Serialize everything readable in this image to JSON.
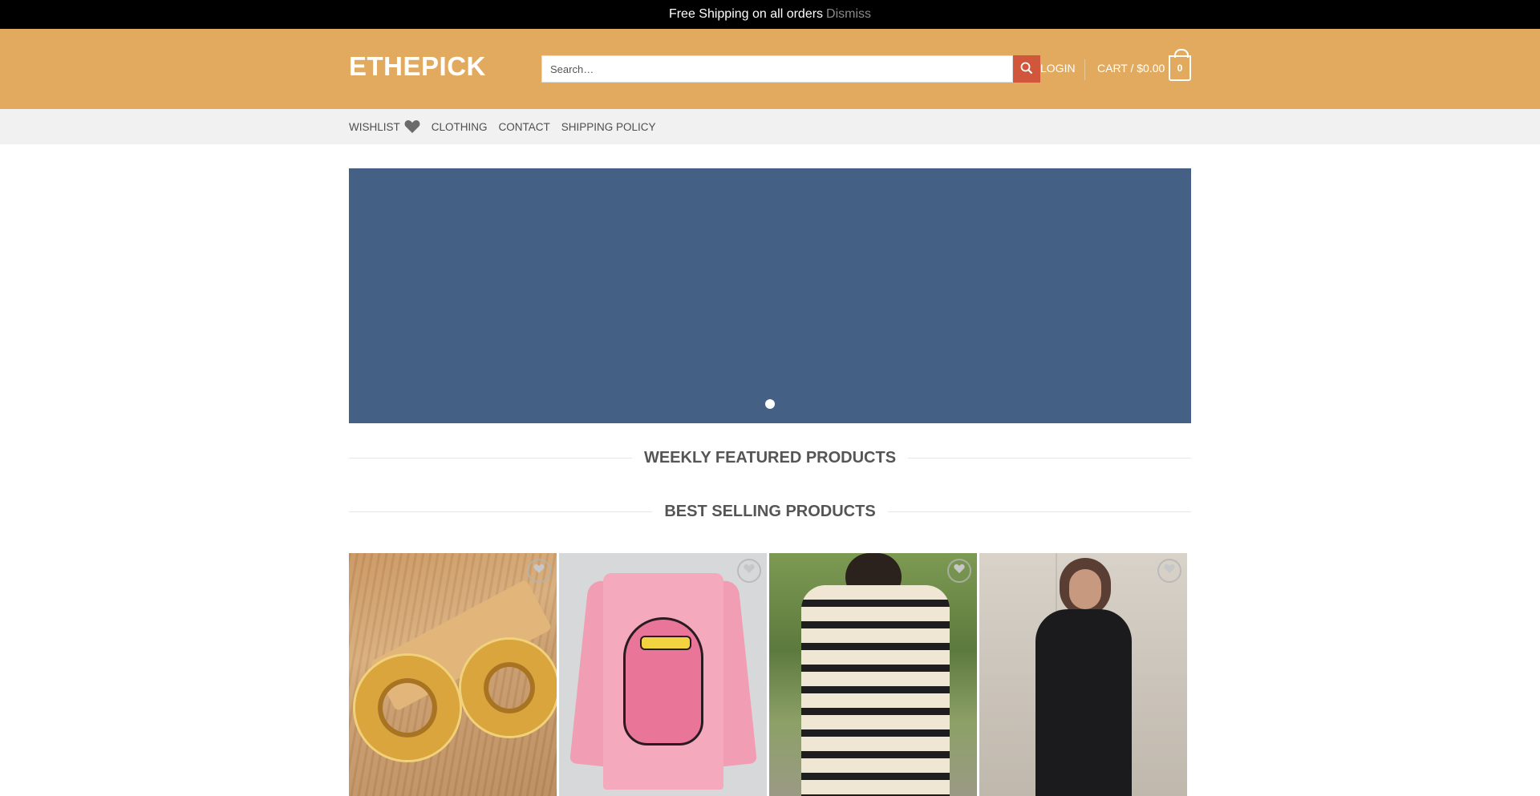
{
  "notice": {
    "message": "Free Shipping on all orders",
    "dismiss": "Dismiss"
  },
  "header": {
    "logo": "ETHEPICK",
    "search_placeholder": "Search…",
    "login": "LOGIN",
    "cart_label": "CART / $0.00",
    "cart_count": "0"
  },
  "nav": {
    "items": [
      "WISHLIST",
      "CLOTHING",
      "CONTACT",
      "SHIPPING POLICY"
    ]
  },
  "hero": {
    "slide_count": 1,
    "active_slide": 1,
    "background": "#446084"
  },
  "sections": {
    "weekly": "WEEKLY FEATURED PRODUCTS",
    "best": "BEST SELLING PRODUCTS"
  },
  "products": [
    {
      "image": "gold-hoop-earrings"
    },
    {
      "image": "pink-panther-sweater"
    },
    {
      "image": "striped-turtleneck-sweater"
    },
    {
      "image": "black-jumpsuit"
    }
  ],
  "colors": {
    "header": "#e1aa5f",
    "search_button": "#d0573c",
    "subnav": "#f1f1f1",
    "notice": "#000000"
  },
  "icons": {
    "search": "search-icon",
    "heart": "heart-icon",
    "cart": "cart-icon",
    "wishlist_button": "heart-outline-icon"
  }
}
